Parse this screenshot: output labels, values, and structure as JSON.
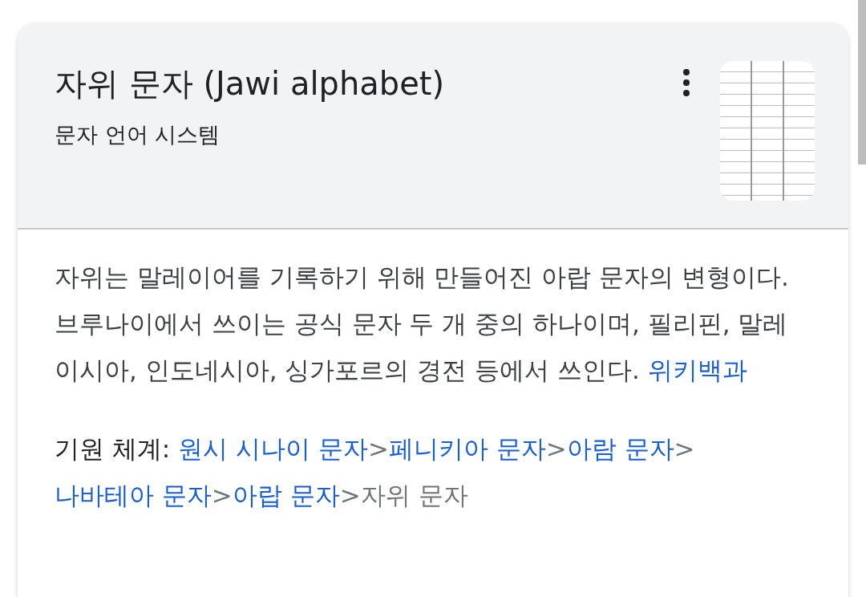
{
  "header": {
    "title": "자위 문자 (Jawi alphabet)",
    "subtitle": "문자 언어 시스템"
  },
  "description": {
    "text": "자위는 말레이어를 기록하기 위해 만들어진 아랍 문자의 변형이다. 브루나이에서 쓰이는 공식 문자 두 개 중의 하나이며, 필리핀, 말레이시아, 인도네시아, 싱가포르의 경전 등에서 쓰인다.",
    "source": "위키백과"
  },
  "lineage": {
    "label": "기원 체계:",
    "separator": ">",
    "items": [
      {
        "text": "원시 시나이 문자",
        "kind": "link"
      },
      {
        "text": "페니키아 문자",
        "kind": "link"
      },
      {
        "text": "아람 문자",
        "kind": "link"
      },
      {
        "text": "나바테아 문자",
        "kind": "link"
      },
      {
        "text": "아랍 문자",
        "kind": "link"
      },
      {
        "text": "자위 문자",
        "kind": "current"
      }
    ]
  }
}
